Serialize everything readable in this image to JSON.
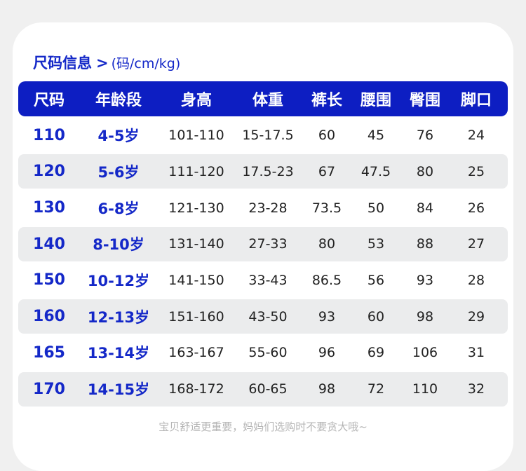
{
  "heading": {
    "title": "尺码信息",
    "arrow": ">",
    "unit": "(码/cm/kg)"
  },
  "table": {
    "headers": [
      "尺码",
      "年龄段",
      "身高",
      "体重",
      "裤长",
      "腰围",
      "臀围",
      "脚口"
    ],
    "rows": [
      [
        "110",
        "4-5岁",
        "101-110",
        "15-17.5",
        "60",
        "45",
        "76",
        "24"
      ],
      [
        "120",
        "5-6岁",
        "111-120",
        "17.5-23",
        "67",
        "47.5",
        "80",
        "25"
      ],
      [
        "130",
        "6-8岁",
        "121-130",
        "23-28",
        "73.5",
        "50",
        "84",
        "26"
      ],
      [
        "140",
        "8-10岁",
        "131-140",
        "27-33",
        "80",
        "53",
        "88",
        "27"
      ],
      [
        "150",
        "10-12岁",
        "141-150",
        "33-43",
        "86.5",
        "56",
        "93",
        "28"
      ],
      [
        "160",
        "12-13岁",
        "151-160",
        "43-50",
        "93",
        "60",
        "98",
        "29"
      ],
      [
        "165",
        "13-14岁",
        "163-167",
        "55-60",
        "96",
        "69",
        "106",
        "31"
      ],
      [
        "170",
        "14-15岁",
        "168-172",
        "60-65",
        "98",
        "72",
        "110",
        "32"
      ]
    ]
  },
  "footer": "宝贝舒适更重要，妈妈们选购时不要贪大哦~",
  "colors": {
    "accent": "#0d1ec2",
    "alt_row": "#ebeced",
    "footer_text": "#b5b5b5"
  }
}
